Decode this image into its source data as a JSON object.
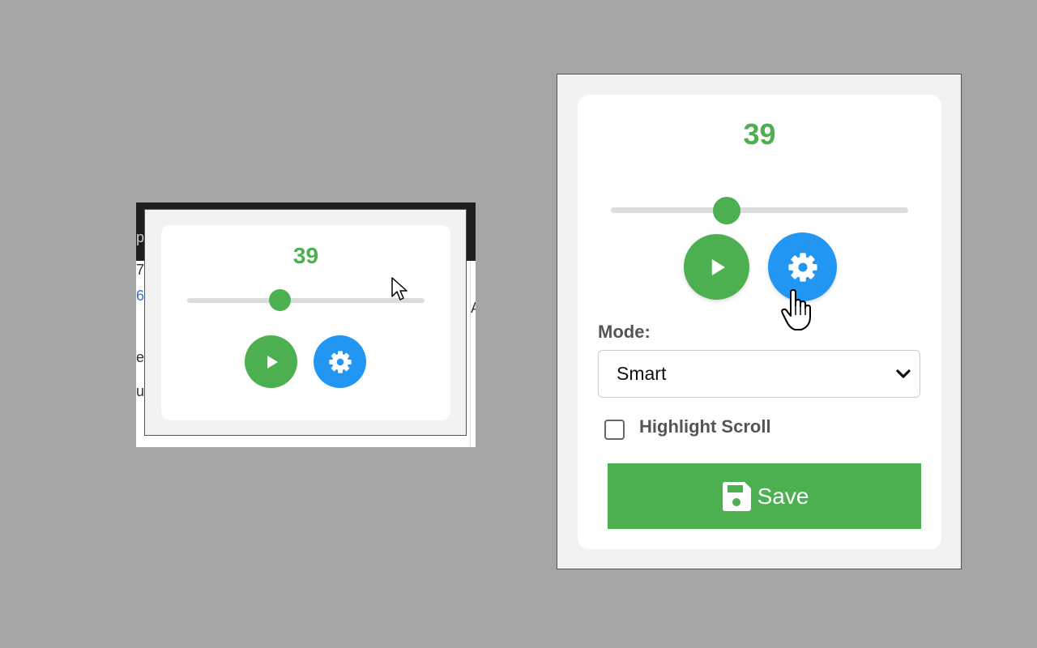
{
  "small_popup": {
    "value": "39",
    "slider_fraction": 0.39,
    "background_fragments": [
      "p",
      "7",
      "6",
      "e",
      "u",
      "A"
    ],
    "buttons": {
      "play_icon": "play-icon",
      "settings_icon": "gear-icon"
    }
  },
  "popup": {
    "value": "39",
    "slider_fraction": 0.39,
    "buttons": {
      "play_icon": "play-icon",
      "settings_icon": "gear-icon"
    },
    "mode": {
      "label": "Mode:",
      "selected": "Smart"
    },
    "highlight_scroll": {
      "label": "Highlight Scroll",
      "checked": false
    },
    "save": {
      "label": "Save",
      "icon": "floppy-disk-icon"
    }
  },
  "colors": {
    "accent_green": "#4caf50",
    "accent_blue": "#2196f3",
    "backdrop": "#a5a5a5"
  }
}
